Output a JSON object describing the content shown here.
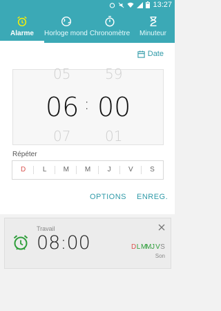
{
  "status": {
    "time": "13:27"
  },
  "tabs": [
    {
      "label": "Alarme",
      "icon": "alarm-icon"
    },
    {
      "label": "Horloge mond…",
      "icon": "world-clock-icon"
    },
    {
      "label": "Chronomètre",
      "icon": "stopwatch-icon"
    },
    {
      "label": "Minuteur",
      "icon": "hourglass-icon"
    }
  ],
  "editor": {
    "date_label": "Date",
    "picker": {
      "hour_prev": "05",
      "hour": "06",
      "hour_next": "07",
      "separator": ":",
      "minute_prev": "59",
      "minute": "00",
      "minute_next": "01"
    },
    "repeat_label": "Répéter",
    "days": [
      "D",
      "L",
      "M",
      "M",
      "J",
      "V",
      "S"
    ],
    "options_label": "OPTIONS",
    "save_label": "ENREG."
  },
  "alarm": {
    "name": "Travail",
    "time": "08:00",
    "days": [
      "D",
      "L",
      "M",
      "M",
      "J",
      "V",
      "S"
    ],
    "sound_label": "Son"
  },
  "colors": {
    "accent": "#3ba9b6",
    "sunday": "#d9534f",
    "active_day": "#2e9e3a",
    "inactive_day": "#888888"
  }
}
